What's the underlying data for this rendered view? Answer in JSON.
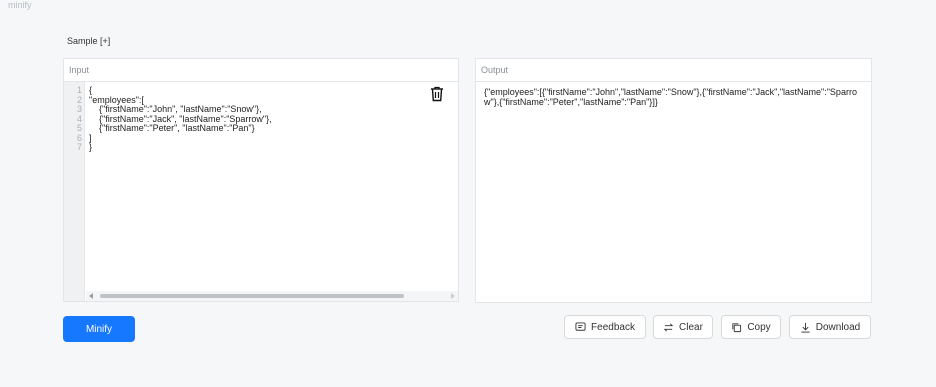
{
  "page": {
    "top_label": "minify"
  },
  "sample": {
    "label": "Sample [+]"
  },
  "input": {
    "header": "Input",
    "line_numbers": [
      "1",
      "2",
      "3",
      "4",
      "5",
      "6",
      "7"
    ],
    "code": "{\n\"employees\":[\n    {\"firstName\":\"John\", \"lastName\":\"Snow\"},\n    {\"firstName\":\"Jack\", \"lastName\":\"Sparrow\"},\n    {\"firstName\":\"Peter\", \"lastName\":\"Pan\"}\n]\n}"
  },
  "output": {
    "header": "Output",
    "text": "{\"employees\":[{\"firstName\":\"John\",\"lastName\":\"Snow\"},{\"firstName\":\"Jack\",\"lastName\":\"Sparrow\"},{\"firstName\":\"Peter\",\"lastName\":\"Pan\"}]}"
  },
  "actions": {
    "minify": "Minify",
    "feedback": "Feedback",
    "clear": "Clear",
    "copy": "Copy",
    "download": "Download"
  },
  "icons": {
    "trash": "trash-icon",
    "feedback": "message-icon",
    "clear": "swap-icon",
    "copy": "copy-icon",
    "download": "download-icon"
  },
  "colors": {
    "primary": "#1677ff"
  }
}
